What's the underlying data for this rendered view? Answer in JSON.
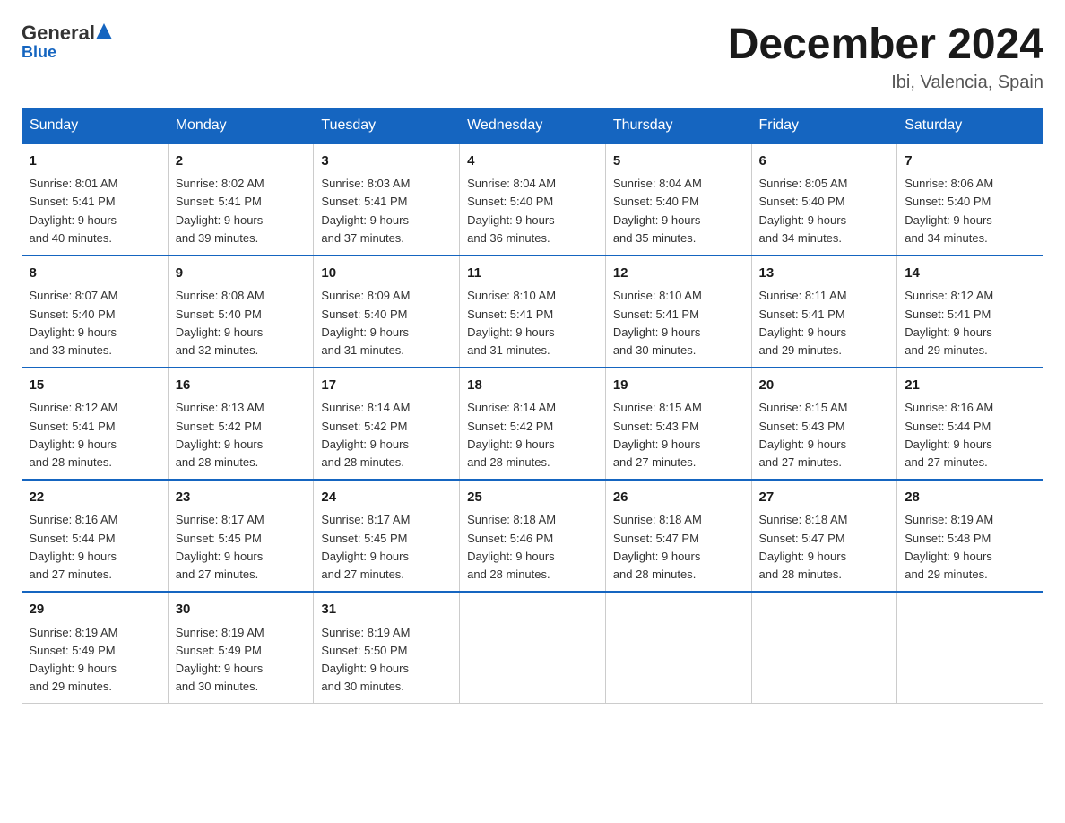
{
  "header": {
    "logo_general": "General",
    "logo_blue": "Blue",
    "page_title": "December 2024",
    "subtitle": "Ibi, Valencia, Spain"
  },
  "days_of_week": [
    "Sunday",
    "Monday",
    "Tuesday",
    "Wednesday",
    "Thursday",
    "Friday",
    "Saturday"
  ],
  "weeks": [
    [
      {
        "day": "1",
        "sunrise": "Sunrise: 8:01 AM",
        "sunset": "Sunset: 5:41 PM",
        "daylight": "Daylight: 9 hours",
        "daylight2": "and 40 minutes."
      },
      {
        "day": "2",
        "sunrise": "Sunrise: 8:02 AM",
        "sunset": "Sunset: 5:41 PM",
        "daylight": "Daylight: 9 hours",
        "daylight2": "and 39 minutes."
      },
      {
        "day": "3",
        "sunrise": "Sunrise: 8:03 AM",
        "sunset": "Sunset: 5:41 PM",
        "daylight": "Daylight: 9 hours",
        "daylight2": "and 37 minutes."
      },
      {
        "day": "4",
        "sunrise": "Sunrise: 8:04 AM",
        "sunset": "Sunset: 5:40 PM",
        "daylight": "Daylight: 9 hours",
        "daylight2": "and 36 minutes."
      },
      {
        "day": "5",
        "sunrise": "Sunrise: 8:04 AM",
        "sunset": "Sunset: 5:40 PM",
        "daylight": "Daylight: 9 hours",
        "daylight2": "and 35 minutes."
      },
      {
        "day": "6",
        "sunrise": "Sunrise: 8:05 AM",
        "sunset": "Sunset: 5:40 PM",
        "daylight": "Daylight: 9 hours",
        "daylight2": "and 34 minutes."
      },
      {
        "day": "7",
        "sunrise": "Sunrise: 8:06 AM",
        "sunset": "Sunset: 5:40 PM",
        "daylight": "Daylight: 9 hours",
        "daylight2": "and 34 minutes."
      }
    ],
    [
      {
        "day": "8",
        "sunrise": "Sunrise: 8:07 AM",
        "sunset": "Sunset: 5:40 PM",
        "daylight": "Daylight: 9 hours",
        "daylight2": "and 33 minutes."
      },
      {
        "day": "9",
        "sunrise": "Sunrise: 8:08 AM",
        "sunset": "Sunset: 5:40 PM",
        "daylight": "Daylight: 9 hours",
        "daylight2": "and 32 minutes."
      },
      {
        "day": "10",
        "sunrise": "Sunrise: 8:09 AM",
        "sunset": "Sunset: 5:40 PM",
        "daylight": "Daylight: 9 hours",
        "daylight2": "and 31 minutes."
      },
      {
        "day": "11",
        "sunrise": "Sunrise: 8:10 AM",
        "sunset": "Sunset: 5:41 PM",
        "daylight": "Daylight: 9 hours",
        "daylight2": "and 31 minutes."
      },
      {
        "day": "12",
        "sunrise": "Sunrise: 8:10 AM",
        "sunset": "Sunset: 5:41 PM",
        "daylight": "Daylight: 9 hours",
        "daylight2": "and 30 minutes."
      },
      {
        "day": "13",
        "sunrise": "Sunrise: 8:11 AM",
        "sunset": "Sunset: 5:41 PM",
        "daylight": "Daylight: 9 hours",
        "daylight2": "and 29 minutes."
      },
      {
        "day": "14",
        "sunrise": "Sunrise: 8:12 AM",
        "sunset": "Sunset: 5:41 PM",
        "daylight": "Daylight: 9 hours",
        "daylight2": "and 29 minutes."
      }
    ],
    [
      {
        "day": "15",
        "sunrise": "Sunrise: 8:12 AM",
        "sunset": "Sunset: 5:41 PM",
        "daylight": "Daylight: 9 hours",
        "daylight2": "and 28 minutes."
      },
      {
        "day": "16",
        "sunrise": "Sunrise: 8:13 AM",
        "sunset": "Sunset: 5:42 PM",
        "daylight": "Daylight: 9 hours",
        "daylight2": "and 28 minutes."
      },
      {
        "day": "17",
        "sunrise": "Sunrise: 8:14 AM",
        "sunset": "Sunset: 5:42 PM",
        "daylight": "Daylight: 9 hours",
        "daylight2": "and 28 minutes."
      },
      {
        "day": "18",
        "sunrise": "Sunrise: 8:14 AM",
        "sunset": "Sunset: 5:42 PM",
        "daylight": "Daylight: 9 hours",
        "daylight2": "and 28 minutes."
      },
      {
        "day": "19",
        "sunrise": "Sunrise: 8:15 AM",
        "sunset": "Sunset: 5:43 PM",
        "daylight": "Daylight: 9 hours",
        "daylight2": "and 27 minutes."
      },
      {
        "day": "20",
        "sunrise": "Sunrise: 8:15 AM",
        "sunset": "Sunset: 5:43 PM",
        "daylight": "Daylight: 9 hours",
        "daylight2": "and 27 minutes."
      },
      {
        "day": "21",
        "sunrise": "Sunrise: 8:16 AM",
        "sunset": "Sunset: 5:44 PM",
        "daylight": "Daylight: 9 hours",
        "daylight2": "and 27 minutes."
      }
    ],
    [
      {
        "day": "22",
        "sunrise": "Sunrise: 8:16 AM",
        "sunset": "Sunset: 5:44 PM",
        "daylight": "Daylight: 9 hours",
        "daylight2": "and 27 minutes."
      },
      {
        "day": "23",
        "sunrise": "Sunrise: 8:17 AM",
        "sunset": "Sunset: 5:45 PM",
        "daylight": "Daylight: 9 hours",
        "daylight2": "and 27 minutes."
      },
      {
        "day": "24",
        "sunrise": "Sunrise: 8:17 AM",
        "sunset": "Sunset: 5:45 PM",
        "daylight": "Daylight: 9 hours",
        "daylight2": "and 27 minutes."
      },
      {
        "day": "25",
        "sunrise": "Sunrise: 8:18 AM",
        "sunset": "Sunset: 5:46 PM",
        "daylight": "Daylight: 9 hours",
        "daylight2": "and 28 minutes."
      },
      {
        "day": "26",
        "sunrise": "Sunrise: 8:18 AM",
        "sunset": "Sunset: 5:47 PM",
        "daylight": "Daylight: 9 hours",
        "daylight2": "and 28 minutes."
      },
      {
        "day": "27",
        "sunrise": "Sunrise: 8:18 AM",
        "sunset": "Sunset: 5:47 PM",
        "daylight": "Daylight: 9 hours",
        "daylight2": "and 28 minutes."
      },
      {
        "day": "28",
        "sunrise": "Sunrise: 8:19 AM",
        "sunset": "Sunset: 5:48 PM",
        "daylight": "Daylight: 9 hours",
        "daylight2": "and 29 minutes."
      }
    ],
    [
      {
        "day": "29",
        "sunrise": "Sunrise: 8:19 AM",
        "sunset": "Sunset: 5:49 PM",
        "daylight": "Daylight: 9 hours",
        "daylight2": "and 29 minutes."
      },
      {
        "day": "30",
        "sunrise": "Sunrise: 8:19 AM",
        "sunset": "Sunset: 5:49 PM",
        "daylight": "Daylight: 9 hours",
        "daylight2": "and 30 minutes."
      },
      {
        "day": "31",
        "sunrise": "Sunrise: 8:19 AM",
        "sunset": "Sunset: 5:50 PM",
        "daylight": "Daylight: 9 hours",
        "daylight2": "and 30 minutes."
      },
      {
        "day": "",
        "sunrise": "",
        "sunset": "",
        "daylight": "",
        "daylight2": ""
      },
      {
        "day": "",
        "sunrise": "",
        "sunset": "",
        "daylight": "",
        "daylight2": ""
      },
      {
        "day": "",
        "sunrise": "",
        "sunset": "",
        "daylight": "",
        "daylight2": ""
      },
      {
        "day": "",
        "sunrise": "",
        "sunset": "",
        "daylight": "",
        "daylight2": ""
      }
    ]
  ]
}
